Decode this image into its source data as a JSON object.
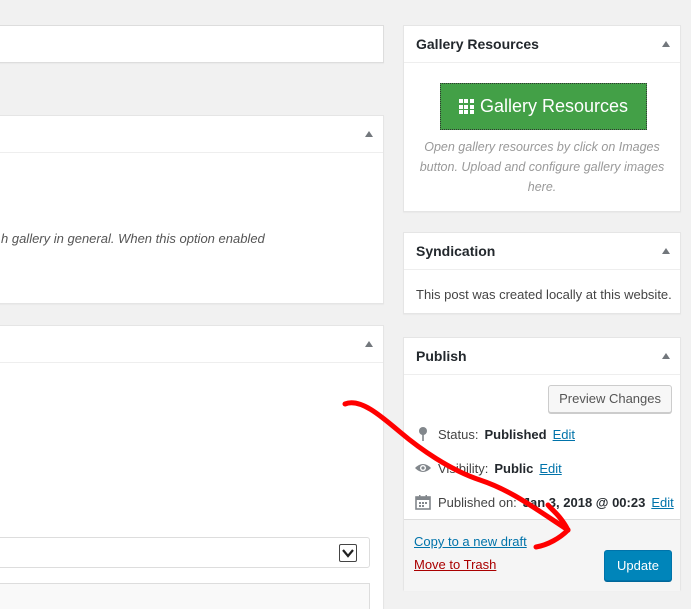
{
  "left": {
    "settings_desc": "h gallery in general. When this option enabled"
  },
  "gallery_resources": {
    "title": "Gallery Resources",
    "button_label": "Gallery Resources",
    "button_icon": "grid-icon",
    "button_color": "#43a047",
    "description": "Open gallery resources by click on Images button. Upload and configure gallery images here."
  },
  "syndication": {
    "title": "Syndication",
    "text": "This post was created locally at this website."
  },
  "publish": {
    "title": "Publish",
    "preview_label": "Preview Changes",
    "status_label": "Status:",
    "status_value": "Published",
    "visibility_label": "Visibility:",
    "visibility_value": "Public",
    "published_label": "Published on:",
    "published_value": "Jan 3, 2018 @ 00:23",
    "edit_label": "Edit",
    "copy_link": "Copy to a new draft",
    "trash_link": "Move to Trash",
    "update_label": "Update",
    "update_color": "#0085ba"
  },
  "annotation": {
    "color": "#ff0000",
    "type": "hand-drawn-arrow"
  }
}
